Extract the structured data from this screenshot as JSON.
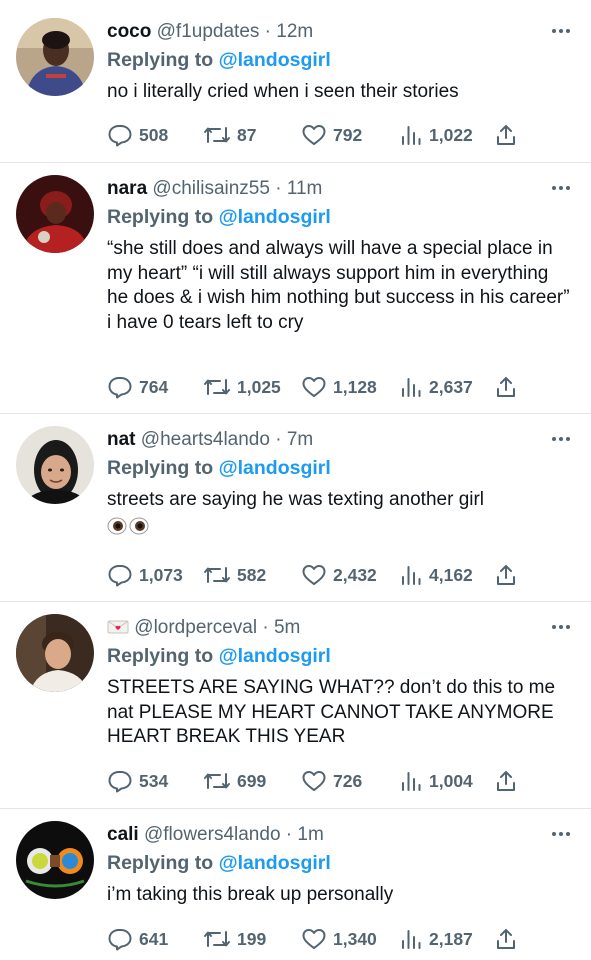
{
  "tweets": [
    {
      "name": "coco",
      "handle": "@f1updates",
      "time": "12m",
      "replying_prefix": "Replying to",
      "replying_to": "@landosgirl",
      "text": "no i literally cried when i seen their stories",
      "stats": {
        "replies": "508",
        "retweets": "87",
        "likes": "792",
        "views": "1,022"
      }
    },
    {
      "name": "nara",
      "handle": "@chilisainz55",
      "time": "11m",
      "replying_prefix": "Replying to",
      "replying_to": "@landosgirl",
      "text": "“she still does and always will have a special place in my heart” “i will still always support him in everything he does & i wish him nothing but success in his career” i have 0 tears left to cry",
      "stats": {
        "replies": "764",
        "retweets": "1,025",
        "likes": "1,128",
        "views": "2,637"
      }
    },
    {
      "name": "nat",
      "handle": "@hearts4lando",
      "time": "7m",
      "replying_prefix": "Replying to",
      "replying_to": "@landosgirl",
      "text": "streets are saying he was texting another girl",
      "emoji": "eyes-emoji",
      "stats": {
        "replies": "1,073",
        "retweets": "582",
        "likes": "2,432",
        "views": "4,162"
      }
    },
    {
      "name_icon": "love-letter-emoji",
      "handle": "@lordperceval",
      "time": "5m",
      "replying_prefix": "Replying to",
      "replying_to": "@landosgirl",
      "text": "STREETS ARE SAYING WHAT?? don’t do this to me nat PLEASE MY HEART CANNOT TAKE ANYMORE HEART BREAK THIS YEAR",
      "stats": {
        "replies": "534",
        "retweets": "699",
        "likes": "726",
        "views": "1,004"
      }
    },
    {
      "name": "cali",
      "handle": "@flowers4lando",
      "time": "1m",
      "replying_prefix": "Replying to",
      "replying_to": "@landosgirl",
      "text": "i’m taking this break up personally",
      "stats": {
        "replies": "641",
        "retweets": "199",
        "likes": "1,340",
        "views": "2,187"
      }
    }
  ],
  "icons": [
    "reply-icon",
    "retweet-icon",
    "like-icon",
    "views-icon",
    "share-icon",
    "more-icon"
  ],
  "colors": {
    "link": "#1d9bf0",
    "secondary": "#536471",
    "primary_text": "#0f1419",
    "divider": "#e1e6ea"
  }
}
